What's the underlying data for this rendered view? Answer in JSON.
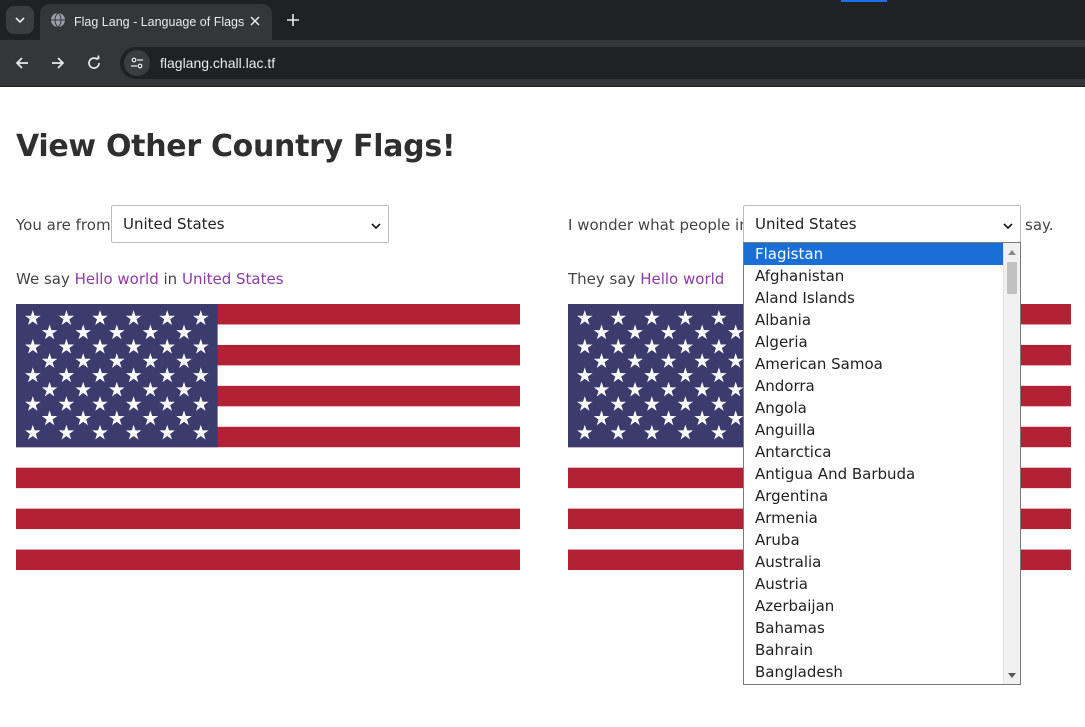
{
  "browser": {
    "tab_title": "Flag Lang - Language of Flags",
    "url": "flaglang.chall.lac.tf",
    "icons": [
      "tab-search-icon",
      "globe-icon",
      "close-icon",
      "plus-icon",
      "back-arrow-icon",
      "forward-arrow-icon",
      "reload-icon",
      "site-info-icon"
    ]
  },
  "page": {
    "title": "View Other Country Flags!",
    "left": {
      "label": "You are from",
      "selected": "United States",
      "sentence_prefix": "We say",
      "greeting": "Hello world",
      "sentence_middle": "in",
      "country_link": "United States"
    },
    "right": {
      "label": "I wonder what people in",
      "selected": "United States",
      "label_suffix": "say.",
      "sentence_prefix": "They say",
      "greeting": "Hello world"
    },
    "dropdown": {
      "highlighted": "Flagistan",
      "options": [
        "Flagistan",
        "Afghanistan",
        "Aland Islands",
        "Albania",
        "Algeria",
        "American Samoa",
        "Andorra",
        "Angola",
        "Anguilla",
        "Antarctica",
        "Antigua And Barbuda",
        "Argentina",
        "Armenia",
        "Aruba",
        "Australia",
        "Austria",
        "Azerbaijan",
        "Bahamas",
        "Bahrain",
        "Bangladesh"
      ]
    },
    "colors": {
      "link": "#8e3aa8",
      "flag_red": "#b22234",
      "flag_blue": "#3c3b6e",
      "highlight": "#1a6fd6"
    }
  }
}
